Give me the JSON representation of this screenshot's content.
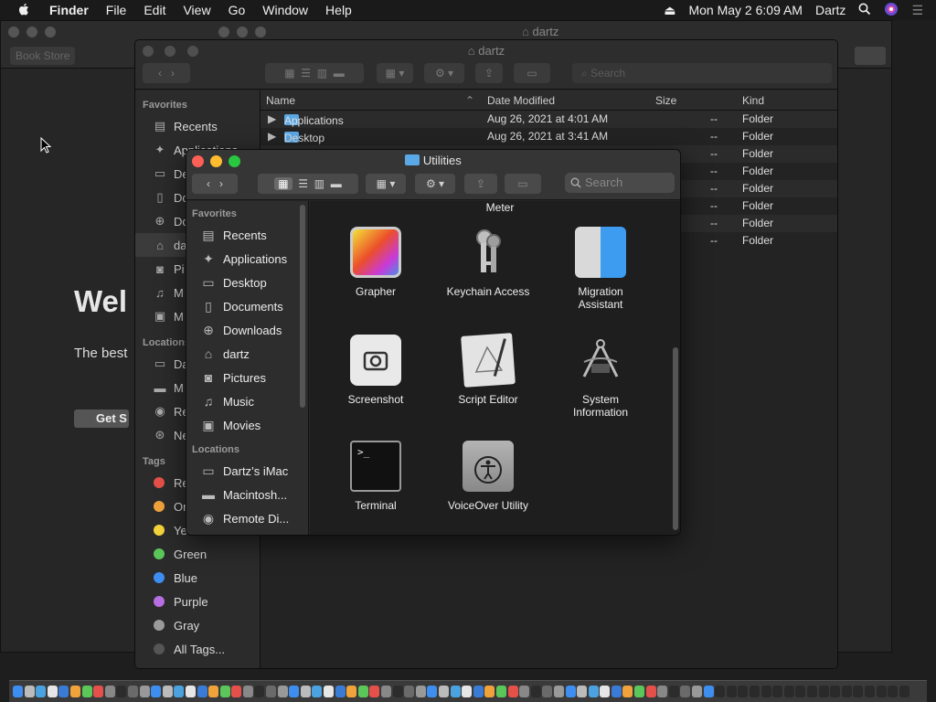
{
  "menubar": {
    "apple": "",
    "items": [
      "Finder",
      "File",
      "Edit",
      "View",
      "Go",
      "Window",
      "Help"
    ],
    "datetime": "Mon May 2  6:09 AM",
    "user": "Dartz"
  },
  "bg_window": {
    "title": "dartz",
    "tab": "Book Store",
    "welcome": "Wel",
    "tagline": "The best",
    "get_button": "Get S"
  },
  "dartz_window": {
    "title": "dartz",
    "search_placeholder": "Search",
    "sidebar": {
      "favorites_header": "Favorites",
      "favorites": [
        {
          "label": "Recents",
          "icon": "recents-icon"
        },
        {
          "label": "Applications",
          "icon": "applications-icon"
        },
        {
          "label": "De",
          "icon": "desktop-icon"
        },
        {
          "label": "Do",
          "icon": "documents-icon"
        },
        {
          "label": "Do",
          "icon": "downloads-icon"
        },
        {
          "label": "da",
          "icon": "home-icon"
        },
        {
          "label": "Pi",
          "icon": "pictures-icon"
        },
        {
          "label": "M",
          "icon": "music-icon"
        },
        {
          "label": "M",
          "icon": "movies-icon"
        }
      ],
      "locations_header": "Locations",
      "locations": [
        {
          "label": "Da",
          "icon": "imac-icon"
        },
        {
          "label": "M",
          "icon": "disk-icon"
        },
        {
          "label": "Re",
          "icon": "remote-disc-icon"
        },
        {
          "label": "Ne",
          "icon": "network-icon"
        }
      ],
      "tags_header": "Tags",
      "tags": [
        {
          "label": "Re",
          "color": "#e5504a"
        },
        {
          "label": "Or",
          "color": "#f0a23b"
        },
        {
          "label": "Ye",
          "color": "#f5d33a"
        },
        {
          "label": "Green",
          "color": "#5bc75a"
        },
        {
          "label": "Blue",
          "color": "#3d8ef0"
        },
        {
          "label": "Purple",
          "color": "#b66ee0"
        },
        {
          "label": "Gray",
          "color": "#9a9a9a"
        },
        {
          "label": "All Tags...",
          "color": "#555555"
        }
      ]
    },
    "columns": {
      "name": "Name",
      "date": "Date Modified",
      "size": "Size",
      "kind": "Kind"
    },
    "rows": [
      {
        "name": "Applications",
        "date": "Aug 26, 2021 at 4:01 AM",
        "size": "--",
        "kind": "Folder"
      },
      {
        "name": "Desktop",
        "date": "Aug 26, 2021 at 3:41 AM",
        "size": "--",
        "kind": "Folder"
      },
      {
        "name": "",
        "date": "",
        "size": "--",
        "kind": "Folder"
      },
      {
        "name": "",
        "date": "",
        "size": "--",
        "kind": "Folder"
      },
      {
        "name": "",
        "date": "",
        "size": "--",
        "kind": "Folder"
      },
      {
        "name": "",
        "date": "",
        "size": "--",
        "kind": "Folder"
      },
      {
        "name": "",
        "date": "",
        "size": "--",
        "kind": "Folder"
      },
      {
        "name": "",
        "date": "",
        "size": "--",
        "kind": "Folder"
      }
    ]
  },
  "util_window": {
    "title": "Utilities",
    "search_placeholder": "Search",
    "sidebar": {
      "favorites_header": "Favorites",
      "favorites": [
        {
          "label": "Recents",
          "icon": "recents-icon"
        },
        {
          "label": "Applications",
          "icon": "applications-icon"
        },
        {
          "label": "Desktop",
          "icon": "desktop-icon"
        },
        {
          "label": "Documents",
          "icon": "documents-icon"
        },
        {
          "label": "Downloads",
          "icon": "downloads-icon"
        },
        {
          "label": "dartz",
          "icon": "home-icon"
        },
        {
          "label": "Pictures",
          "icon": "pictures-icon"
        },
        {
          "label": "Music",
          "icon": "music-icon"
        },
        {
          "label": "Movies",
          "icon": "movies-icon"
        }
      ],
      "locations_header": "Locations",
      "locations": [
        {
          "label": "Dartz’s iMac",
          "icon": "imac-icon"
        },
        {
          "label": "Macintosh...",
          "icon": "disk-icon"
        },
        {
          "label": "Remote Di...",
          "icon": "remote-disc-icon"
        }
      ]
    },
    "meter_label": "Meter",
    "apps": [
      {
        "label": "Grapher",
        "label2": "",
        "icon": "grapher-icon"
      },
      {
        "label": "Keychain Access",
        "label2": "",
        "icon": "keychain-icon"
      },
      {
        "label": "Migration",
        "label2": "Assistant",
        "icon": "migration-assistant-icon"
      },
      {
        "label": "Screenshot",
        "label2": "",
        "icon": "screenshot-icon"
      },
      {
        "label": "Script Editor",
        "label2": "",
        "icon": "script-editor-icon"
      },
      {
        "label": "System",
        "label2": "Information",
        "icon": "system-information-icon"
      },
      {
        "label": "Terminal",
        "label2": "",
        "icon": "terminal-icon"
      },
      {
        "label": "VoiceOver Utility",
        "label2": "",
        "icon": "voiceover-icon"
      }
    ]
  }
}
